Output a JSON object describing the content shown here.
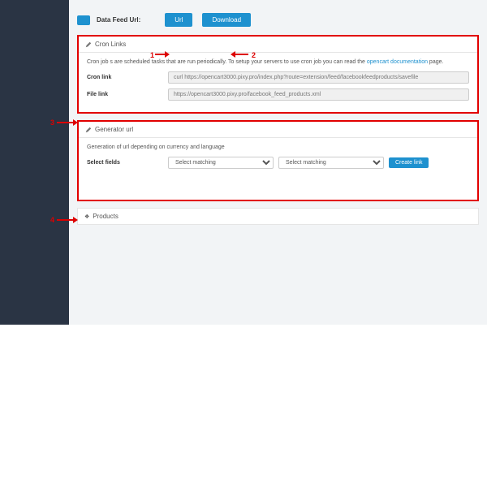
{
  "topbar": {
    "label": "Data Feed Url:",
    "url_btn": "Url",
    "download_btn": "Download"
  },
  "annotations": {
    "n1": "1",
    "n2": "2",
    "n3": "3",
    "n4": "4"
  },
  "cron": {
    "title": "Cron Links",
    "desc_pre": "Cron job s are scheduled tasks that are run periodically. To setup your servers to use cron job you can read the ",
    "doc_link": "opencart documentation",
    "desc_post": " page.",
    "cron_label": "Cron link",
    "cron_value": "curl https://opencart3000.pixy.pro/index.php?route=extension/feed/facebookfeedproducts/savefile",
    "file_label": "File link",
    "file_value": "https://opencart3000.pixy.pro/facebook_feed_products.xml"
  },
  "gen": {
    "title": "Generator url",
    "desc": "Generation of url depending on currency and language",
    "select_label": "Select fields",
    "placeholder": "Select matching",
    "create_btn": "Create link"
  },
  "products": {
    "title": "Products"
  }
}
